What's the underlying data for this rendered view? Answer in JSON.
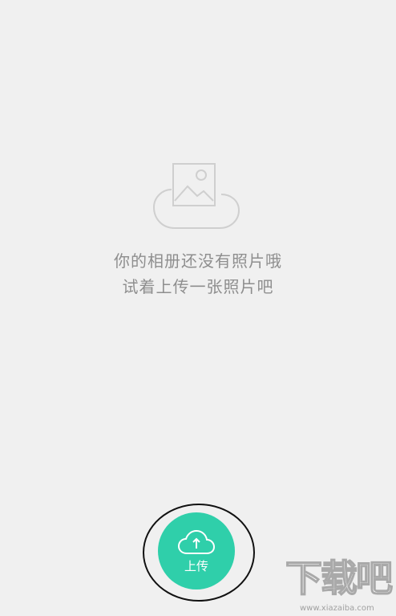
{
  "empty_state": {
    "illustration_icon": "cloud-photo-icon",
    "message_line1": "你的相册还没有照片哦",
    "message_line2": "试着上传一张照片吧"
  },
  "upload_button": {
    "icon": "cloud-upload-icon",
    "label": "上传",
    "color": "#2fcfaa"
  },
  "watermark": {
    "logo_text": "下载吧",
    "url": "www.xiazaiba.com"
  }
}
